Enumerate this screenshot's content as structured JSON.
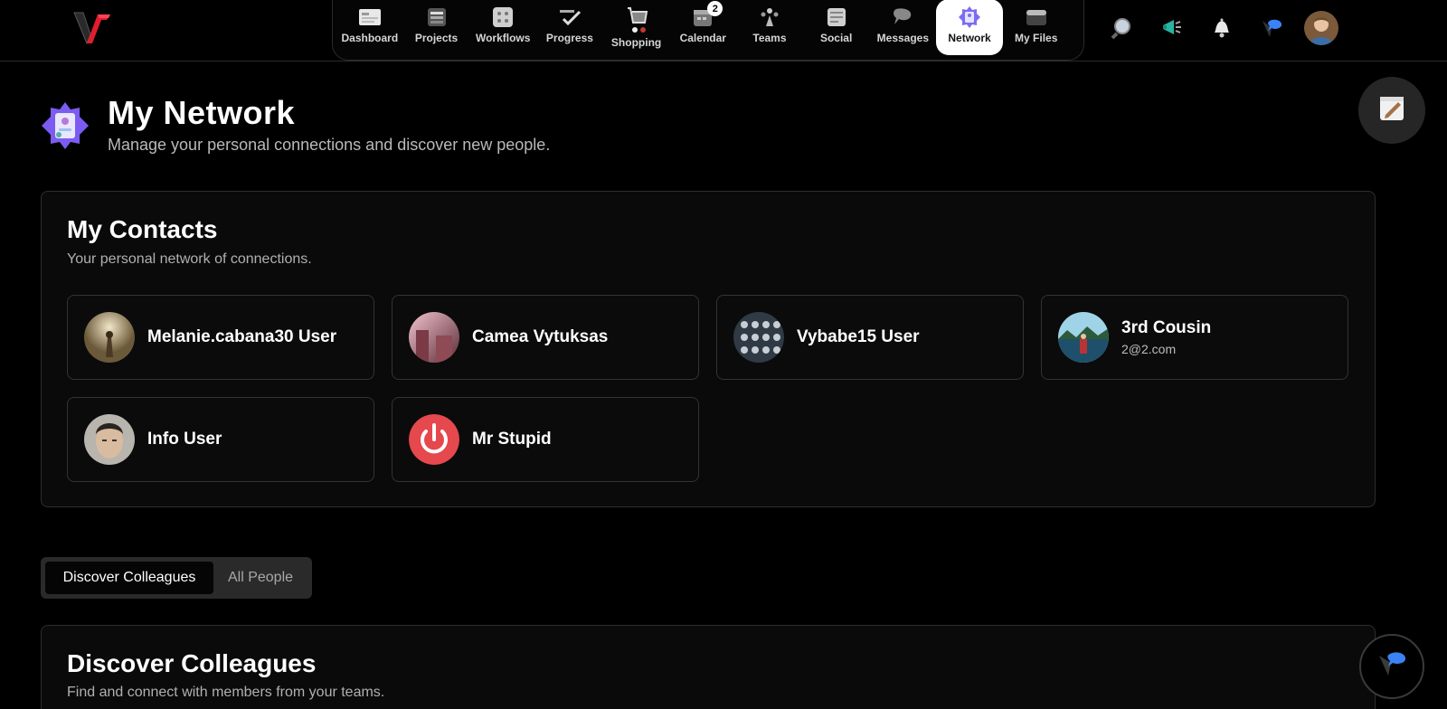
{
  "nav": {
    "items": [
      {
        "label": "Dashboard",
        "icon": "dashboard-icon"
      },
      {
        "label": "Projects",
        "icon": "projects-icon"
      },
      {
        "label": "Workflows",
        "icon": "workflows-icon"
      },
      {
        "label": "Progress",
        "icon": "progress-icon"
      },
      {
        "label": "Shopping",
        "icon": "shopping-cart-icon"
      },
      {
        "label": "Calendar",
        "icon": "calendar-icon",
        "badge": "2"
      },
      {
        "label": "Teams",
        "icon": "teams-icon"
      },
      {
        "label": "Social",
        "icon": "social-icon"
      },
      {
        "label": "Messages",
        "icon": "messages-icon"
      },
      {
        "label": "Network",
        "icon": "network-icon",
        "active": true
      },
      {
        "label": "My Files",
        "icon": "files-icon"
      }
    ]
  },
  "header": {
    "title": "My Network",
    "subtitle": "Manage your personal connections and discover new people."
  },
  "contacts": {
    "title": "My Contacts",
    "subtitle": "Your personal network of connections.",
    "items": [
      {
        "name": "Melanie.cabana30 User",
        "email": ""
      },
      {
        "name": "Camea Vytuksas",
        "email": ""
      },
      {
        "name": "Vybabe15 User",
        "email": ""
      },
      {
        "name": "3rd Cousin",
        "email": "2@2.com"
      },
      {
        "name": "Info User",
        "email": ""
      },
      {
        "name": "Mr Stupid",
        "email": ""
      }
    ]
  },
  "tabs": {
    "discover": "Discover Colleagues",
    "all": "All People"
  },
  "discover": {
    "title": "Discover Colleagues",
    "subtitle": "Find and connect with members from your teams."
  },
  "colors": {
    "background": "#000000",
    "panel": "#0a0a0a",
    "border": "#2e2e2e",
    "accent_blue": "#3b82f6",
    "power_red": "#e5484d"
  }
}
